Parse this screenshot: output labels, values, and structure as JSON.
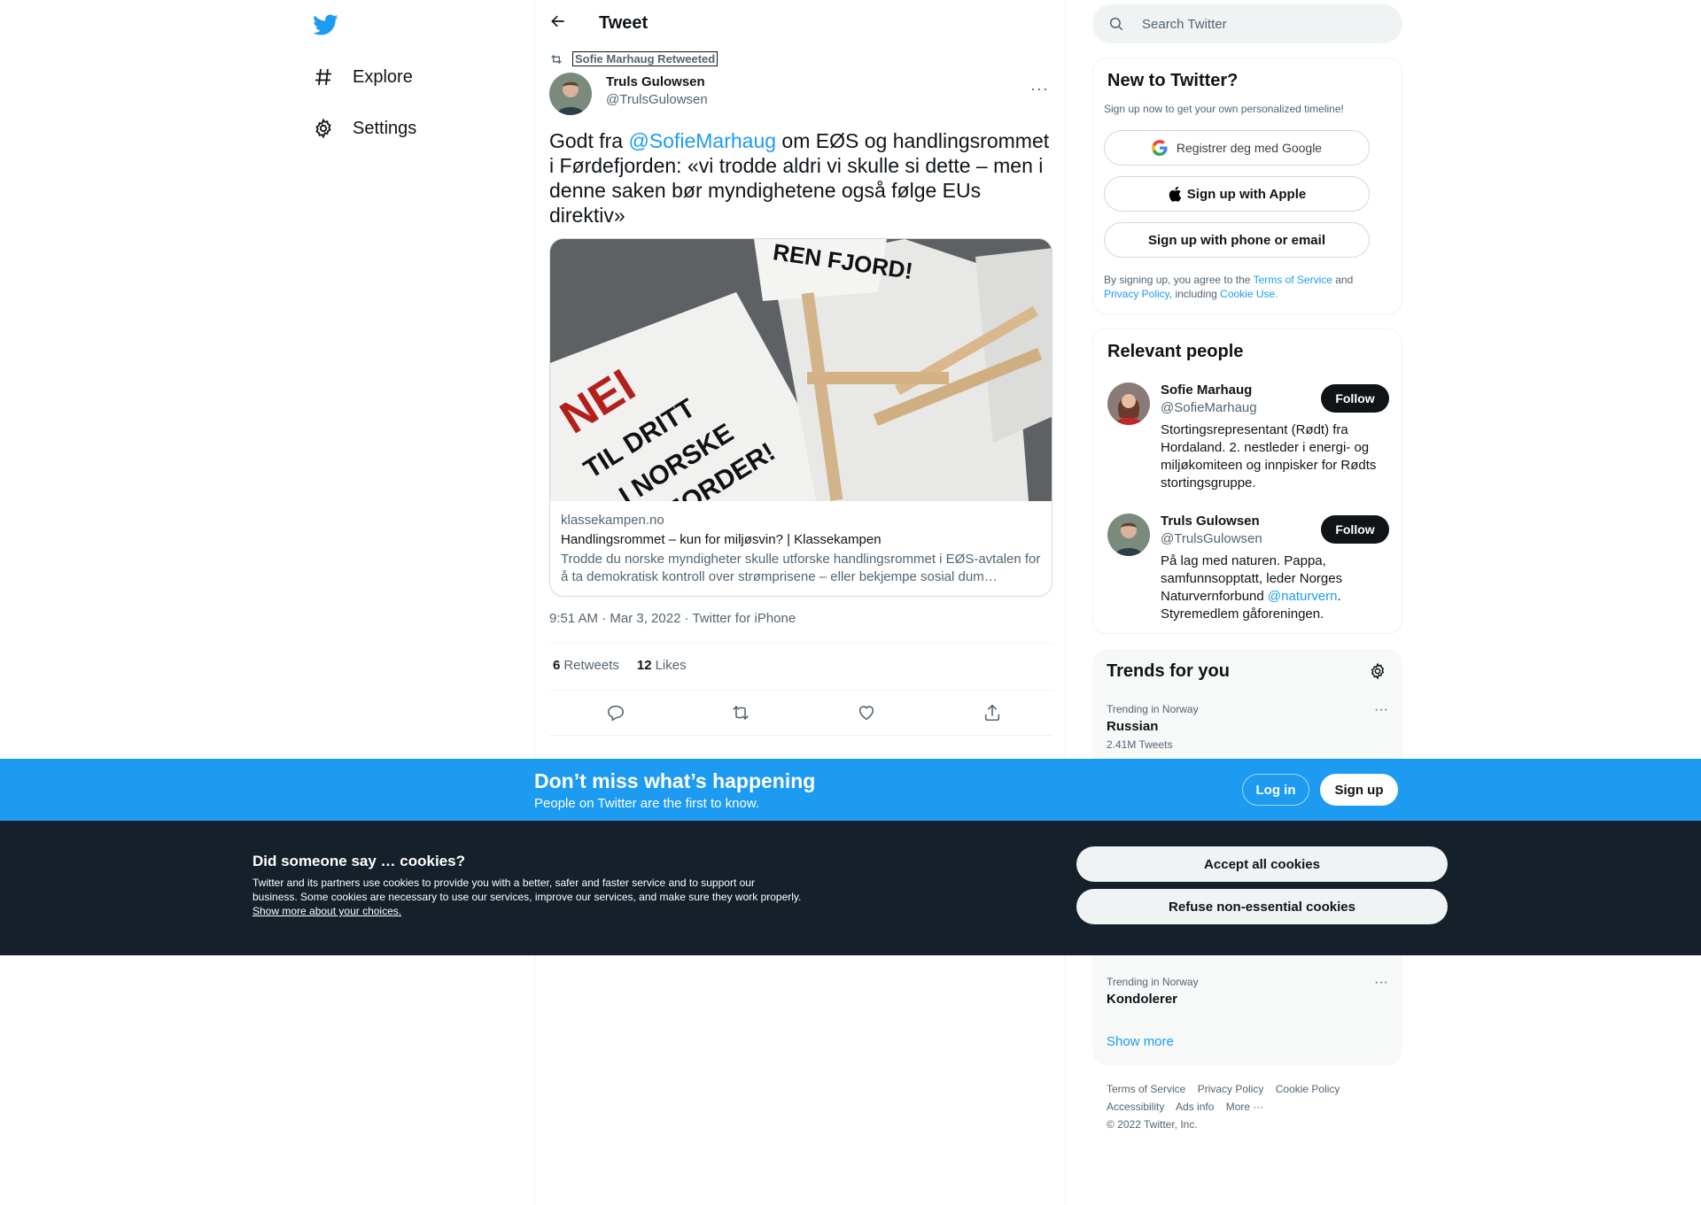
{
  "nav": {
    "items": [
      {
        "label": "Explore",
        "icon": "hashtag-icon"
      },
      {
        "label": "Settings",
        "icon": "gear-icon"
      }
    ]
  },
  "header": {
    "title": "Tweet"
  },
  "tweet": {
    "retweeted_by": "Sofie Marhaug Retweeted",
    "author_name": "Truls Gulowsen",
    "author_handle": "@TrulsGulowsen",
    "text_before": "Godt fra ",
    "mention": "@SofieMarhaug",
    "text_after": " om EØS og handlingsrommet i Førdefjorden: «vi trodde aldri vi skulle si dette – men i denne saken bør myndighetene også følge EUs direktiv»",
    "card": {
      "domain": "klassekampen.no",
      "title": "Handlingsrommet – kun for miljøsvin? | Klassekampen",
      "description": "Trodde du norske myndigheter skulle utforske handlingsrommet i EØS-avtalen for å ta demokratisk kontroll over strømprisene – eller bekjempe sosial dum…",
      "image_signs": [
        "REN FJORD!",
        "NEI",
        "TIL DRITT",
        "I NORSKE",
        "FJORDER!"
      ]
    },
    "timestamp": "9:51 AM · Mar 3, 2022 · Twitter for iPhone",
    "retweets_count": "6",
    "retweets_label": "Retweets",
    "likes_count": "12",
    "likes_label": "Likes"
  },
  "search": {
    "placeholder": "Search Twitter"
  },
  "new_to_twitter": {
    "title": "New to Twitter?",
    "subtitle": "Sign up now to get your own personalized timeline!",
    "google_label": "Registrer deg med Google",
    "apple_label": "Sign up with Apple",
    "phone_label": "Sign up with phone or email",
    "terms_1": "By signing up, you agree to the ",
    "terms_link1": "Terms of Service",
    "terms_2": " and ",
    "terms_link2": "Privacy Policy",
    "terms_3": ", including ",
    "terms_link3": "Cookie Use."
  },
  "relevant_people": {
    "title": "Relevant people",
    "people": [
      {
        "name": "Sofie Marhaug",
        "handle": "@SofieMarhaug",
        "bio": "Stortingsrepresentant (Rødt) fra Hordaland. 2. nestleder i energi- og miljøkomiteen og innpisker for Rødts stortingsgruppe.",
        "follow": "Follow"
      },
      {
        "name": "Truls Gulowsen",
        "handle": "@TrulsGulowsen",
        "bio_before": "På lag med naturen. Pappa, samfunnsopptatt, leder Norges Naturvernforbund ",
        "bio_link": "@naturvern",
        "bio_after": ". Styremedlem gåforeningen.",
        "follow": "Follow"
      }
    ]
  },
  "trends": {
    "title": "Trends for you",
    "items": [
      {
        "context": "Trending in Norway",
        "name": "Russian",
        "count": "2.41M Tweets"
      },
      {
        "context": "Trending in Norway",
        "name": "Kondolerer",
        "count": ""
      }
    ],
    "show_more": "Show more"
  },
  "footer": {
    "links": [
      "Terms of Service",
      "Privacy Policy",
      "Cookie Policy",
      "Accessibility",
      "Ads info",
      "More ···"
    ],
    "copyright": "© 2022 Twitter, Inc."
  },
  "bottom_bar": {
    "title": "Don’t miss what’s happening",
    "subtitle": "People on Twitter are the first to know.",
    "login": "Log in",
    "signup": "Sign up"
  },
  "cookies": {
    "title": "Did someone say … cookies?",
    "text": "Twitter and its partners use cookies to provide you with a better, safer and faster service and to support our business. Some cookies are necessary to use our services, improve our services, and make sure they work properly. ",
    "link": "Show more about your choices.",
    "accept": "Accept all cookies",
    "refuse": "Refuse non-essential cookies"
  },
  "colors": {
    "brand": "#1d9bf0",
    "text": "#0f1419",
    "secondary": "#536471",
    "cookie_bg": "#15202b"
  }
}
